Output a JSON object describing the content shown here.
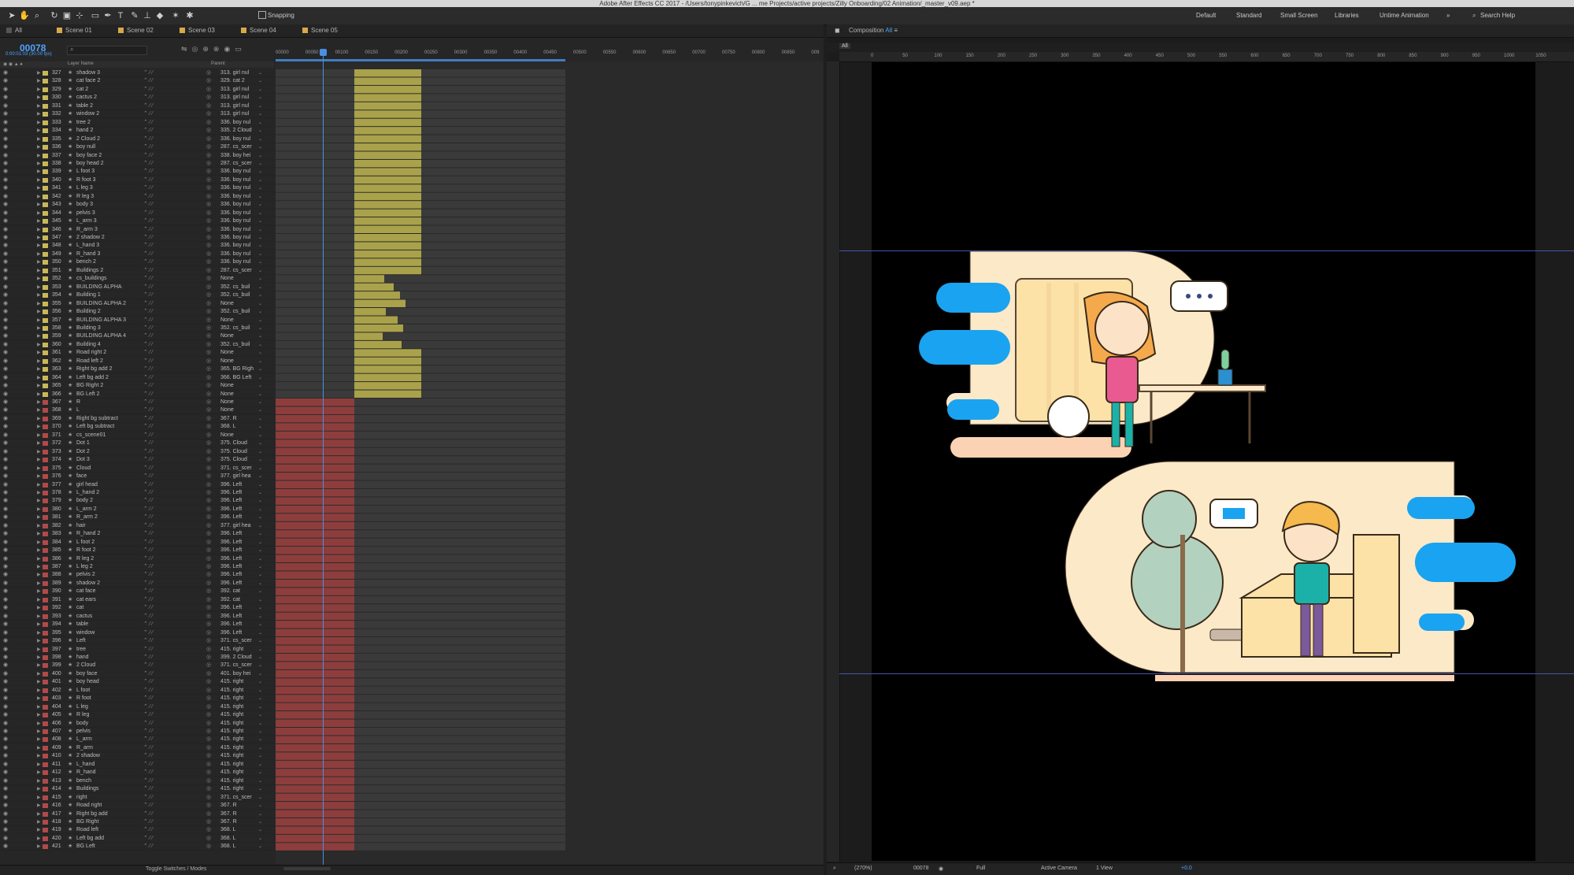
{
  "window_title": "Adobe After Effects CC 2017 - /Users/tonypinkevich/G ... me Projects/active projects/Zilly Onboarding/02 Animation/_master_v09.aep *",
  "toolbar": {
    "snapping": "Snapping",
    "workspaces": [
      "Default",
      "Standard",
      "Small Screen",
      "Libraries",
      "Untime Animation"
    ],
    "search": "Search Help"
  },
  "timeline": {
    "tabs": [
      "All",
      "Scene 01",
      "Scene 02",
      "Scene 03",
      "Scene 04",
      "Scene 05"
    ],
    "timecode": "00078",
    "timecode_sub": "0:00:01:03 (30.00 fps)",
    "columns": {
      "layer_name": "Layer Name",
      "parent": "Parent"
    },
    "ruler": [
      "00000",
      "00050",
      "00100",
      "00150",
      "00200",
      "00250",
      "00300",
      "00350",
      "00400",
      "00450",
      "00500",
      "00550",
      "00600",
      "00650",
      "00700",
      "00750",
      "00800",
      "00850",
      "009"
    ],
    "toggle": "Toggle Switches / Modes",
    "layers": [
      {
        "n": "327",
        "name": "shadow 3",
        "parent": "313. girl nul",
        "c": "#c9b85a"
      },
      {
        "n": "328",
        "name": "cat face 2",
        "parent": "329. cat 2",
        "c": "#c9b85a"
      },
      {
        "n": "329",
        "name": "cat 2",
        "parent": "313. girl nul",
        "c": "#c9b85a"
      },
      {
        "n": "330",
        "name": "cactus 2",
        "parent": "313. girl nul",
        "c": "#c9b85a"
      },
      {
        "n": "331",
        "name": "table 2",
        "parent": "313. girl nul",
        "c": "#c9b85a"
      },
      {
        "n": "332",
        "name": "window 2",
        "parent": "313. girl nul",
        "c": "#c9b85a"
      },
      {
        "n": "333",
        "name": "tree 2",
        "parent": "336. boy nul",
        "c": "#c9b85a"
      },
      {
        "n": "334",
        "name": "hand 2",
        "parent": "335. 2 Cloud",
        "c": "#c9b85a"
      },
      {
        "n": "335",
        "name": "2 Cloud 2",
        "parent": "336. boy nul",
        "c": "#c9b85a"
      },
      {
        "n": "336",
        "name": "boy null",
        "parent": "287. cs_scer",
        "c": "#c9b85a"
      },
      {
        "n": "337",
        "name": "boy face 2",
        "parent": "338. boy hei",
        "c": "#c9b85a"
      },
      {
        "n": "338",
        "name": "boy head 2",
        "parent": "287. cs_scer",
        "c": "#c9b85a"
      },
      {
        "n": "339",
        "name": "L foot 3",
        "parent": "336. boy nul",
        "c": "#c9b85a"
      },
      {
        "n": "340",
        "name": "R foot 3",
        "parent": "336. boy nul",
        "c": "#c9b85a"
      },
      {
        "n": "341",
        "name": "L leg 3",
        "parent": "336. boy nul",
        "c": "#c9b85a"
      },
      {
        "n": "342",
        "name": "R leg 3",
        "parent": "336. boy nul",
        "c": "#c9b85a"
      },
      {
        "n": "343",
        "name": "body 3",
        "parent": "336. boy nul",
        "c": "#c9b85a"
      },
      {
        "n": "344",
        "name": "pelvis 3",
        "parent": "336. boy nul",
        "c": "#c9b85a"
      },
      {
        "n": "345",
        "name": "L_arm 3",
        "parent": "336. boy nul",
        "c": "#c9b85a"
      },
      {
        "n": "346",
        "name": "R_arm 3",
        "parent": "336. boy nul",
        "c": "#c9b85a"
      },
      {
        "n": "347",
        "name": "2 shadow 2",
        "parent": "336. boy nul",
        "c": "#c9b85a"
      },
      {
        "n": "348",
        "name": "L_hand 3",
        "parent": "336. boy nul",
        "c": "#c9b85a"
      },
      {
        "n": "349",
        "name": "R_hand 3",
        "parent": "336. boy nul",
        "c": "#c9b85a"
      },
      {
        "n": "350",
        "name": "bench 2",
        "parent": "336. boy nul",
        "c": "#c9b85a"
      },
      {
        "n": "351",
        "name": "Buildings 2",
        "parent": "287. cs_scer",
        "c": "#c9b85a"
      },
      {
        "n": "352",
        "name": "cs_buildings",
        "parent": "None",
        "c": "#c9b85a"
      },
      {
        "n": "353",
        "name": "BUILDING ALPHA",
        "parent": "352. cs_buil",
        "c": "#c9b85a"
      },
      {
        "n": "354",
        "name": "Building 1",
        "parent": "352. cs_buil",
        "c": "#c9b85a"
      },
      {
        "n": "355",
        "name": "BUILDING ALPHA 2",
        "parent": "None",
        "c": "#c9b85a"
      },
      {
        "n": "356",
        "name": "Building 2",
        "parent": "352. cs_buil",
        "c": "#c9b85a"
      },
      {
        "n": "357",
        "name": "BUILDING ALPHA 3",
        "parent": "None",
        "c": "#c9b85a"
      },
      {
        "n": "358",
        "name": "Building 3",
        "parent": "352. cs_buil",
        "c": "#c9b85a"
      },
      {
        "n": "359",
        "name": "BUILDING ALPHA 4",
        "parent": "None",
        "c": "#c9b85a"
      },
      {
        "n": "360",
        "name": "Building 4",
        "parent": "352. cs_buil",
        "c": "#c9b85a"
      },
      {
        "n": "361",
        "name": "Road right 2",
        "parent": "None",
        "c": "#c9b85a"
      },
      {
        "n": "362",
        "name": "Road left 2",
        "parent": "None",
        "c": "#c9b85a"
      },
      {
        "n": "363",
        "name": "Right bg add 2",
        "parent": "365. BG Righ",
        "c": "#c9b85a"
      },
      {
        "n": "364",
        "name": "Left bg add 2",
        "parent": "366. BG Left",
        "c": "#c9b85a"
      },
      {
        "n": "365",
        "name": "BG Right 2",
        "parent": "None",
        "c": "#c9b85a"
      },
      {
        "n": "366",
        "name": "BG Left 2",
        "parent": "None",
        "c": "#c9b85a"
      },
      {
        "n": "367",
        "name": "R",
        "parent": "None",
        "c": "#b04a4a"
      },
      {
        "n": "368",
        "name": "L",
        "parent": "None",
        "c": "#b04a4a"
      },
      {
        "n": "369",
        "name": "Right bg subtract",
        "parent": "367. R",
        "c": "#b04a4a"
      },
      {
        "n": "370",
        "name": "Left bg subtract",
        "parent": "368. L",
        "c": "#b04a4a"
      },
      {
        "n": "371",
        "name": "cs_scene01",
        "parent": "None",
        "c": "#b04a4a"
      },
      {
        "n": "372",
        "name": "Dot 1",
        "parent": "375. Cloud",
        "c": "#b04a4a"
      },
      {
        "n": "373",
        "name": "Dot 2",
        "parent": "375. Cloud",
        "c": "#b04a4a"
      },
      {
        "n": "374",
        "name": "Dot 3",
        "parent": "375. Cloud",
        "c": "#b04a4a"
      },
      {
        "n": "375",
        "name": "Cloud",
        "parent": "371. cs_scer",
        "c": "#b04a4a"
      },
      {
        "n": "376",
        "name": "face",
        "parent": "377. girl hea",
        "c": "#b04a4a"
      },
      {
        "n": "377",
        "name": "girl head",
        "parent": "396. Left",
        "c": "#b04a4a"
      },
      {
        "n": "378",
        "name": "L_hand 2",
        "parent": "396. Left",
        "c": "#b04a4a"
      },
      {
        "n": "379",
        "name": "body 2",
        "parent": "396. Left",
        "c": "#b04a4a"
      },
      {
        "n": "380",
        "name": "L_arm 2",
        "parent": "396. Left",
        "c": "#b04a4a"
      },
      {
        "n": "381",
        "name": "R_arm 2",
        "parent": "396. Left",
        "c": "#b04a4a"
      },
      {
        "n": "382",
        "name": "hair",
        "parent": "377. girl hea",
        "c": "#b04a4a"
      },
      {
        "n": "383",
        "name": "R_hand 2",
        "parent": "396. Left",
        "c": "#b04a4a"
      },
      {
        "n": "384",
        "name": "L foot 2",
        "parent": "396. Left",
        "c": "#b04a4a"
      },
      {
        "n": "385",
        "name": "R foot 2",
        "parent": "396. Left",
        "c": "#b04a4a"
      },
      {
        "n": "386",
        "name": "R leg 2",
        "parent": "396. Left",
        "c": "#b04a4a"
      },
      {
        "n": "387",
        "name": "L leg 2",
        "parent": "396. Left",
        "c": "#b04a4a"
      },
      {
        "n": "388",
        "name": "pelvis 2",
        "parent": "396. Left",
        "c": "#b04a4a"
      },
      {
        "n": "389",
        "name": "shadow 2",
        "parent": "396. Left",
        "c": "#b04a4a"
      },
      {
        "n": "390",
        "name": "cat face",
        "parent": "392. cat",
        "c": "#b04a4a"
      },
      {
        "n": "391",
        "name": "cat ears",
        "parent": "392. cat",
        "c": "#b04a4a"
      },
      {
        "n": "392",
        "name": "cat",
        "parent": "396. Left",
        "c": "#b04a4a"
      },
      {
        "n": "393",
        "name": "cactus",
        "parent": "396. Left",
        "c": "#b04a4a"
      },
      {
        "n": "394",
        "name": "table",
        "parent": "396. Left",
        "c": "#b04a4a"
      },
      {
        "n": "395",
        "name": "window",
        "parent": "396. Left",
        "c": "#b04a4a"
      },
      {
        "n": "396",
        "name": "Left",
        "parent": "371. cs_scer",
        "c": "#b04a4a"
      },
      {
        "n": "397",
        "name": "tree",
        "parent": "415. right",
        "c": "#b04a4a"
      },
      {
        "n": "398",
        "name": "hand",
        "parent": "399. 2 Cloud",
        "c": "#b04a4a"
      },
      {
        "n": "399",
        "name": "2 Cloud",
        "parent": "371. cs_scer",
        "c": "#b04a4a"
      },
      {
        "n": "400",
        "name": "boy face",
        "parent": "401. boy hei",
        "c": "#b04a4a"
      },
      {
        "n": "401",
        "name": "boy head",
        "parent": "415. right",
        "c": "#b04a4a"
      },
      {
        "n": "402",
        "name": "L foot",
        "parent": "415. right",
        "c": "#b04a4a"
      },
      {
        "n": "403",
        "name": "R foot",
        "parent": "415. right",
        "c": "#b04a4a"
      },
      {
        "n": "404",
        "name": "L leg",
        "parent": "415. right",
        "c": "#b04a4a"
      },
      {
        "n": "405",
        "name": "R leg",
        "parent": "415. right",
        "c": "#b04a4a"
      },
      {
        "n": "406",
        "name": "body",
        "parent": "415. right",
        "c": "#b04a4a"
      },
      {
        "n": "407",
        "name": "pelvis",
        "parent": "415. right",
        "c": "#b04a4a"
      },
      {
        "n": "408",
        "name": "L_arm",
        "parent": "415. right",
        "c": "#b04a4a"
      },
      {
        "n": "409",
        "name": "R_arm",
        "parent": "415. right",
        "c": "#b04a4a"
      },
      {
        "n": "410",
        "name": "2 shadow",
        "parent": "415. right",
        "c": "#b04a4a"
      },
      {
        "n": "411",
        "name": "L_hand",
        "parent": "415. right",
        "c": "#b04a4a"
      },
      {
        "n": "412",
        "name": "R_hand",
        "parent": "415. right",
        "c": "#b04a4a"
      },
      {
        "n": "413",
        "name": "bench",
        "parent": "415. right",
        "c": "#b04a4a"
      },
      {
        "n": "414",
        "name": "Buildings",
        "parent": "415. right",
        "c": "#b04a4a"
      },
      {
        "n": "415",
        "name": "right",
        "parent": "371. cs_scer",
        "c": "#b04a4a"
      },
      {
        "n": "416",
        "name": "Road right",
        "parent": "367. R",
        "c": "#b04a4a"
      },
      {
        "n": "417",
        "name": "Right bg add",
        "parent": "367. R",
        "c": "#b04a4a"
      },
      {
        "n": "418",
        "name": "BG Right",
        "parent": "367. R",
        "c": "#b04a4a"
      },
      {
        "n": "419",
        "name": "Road left",
        "parent": "368. L",
        "c": "#b04a4a"
      },
      {
        "n": "420",
        "name": "Left bg add",
        "parent": "368. L",
        "c": "#b04a4a"
      },
      {
        "n": "421",
        "name": "BG Left",
        "parent": "368. L",
        "c": "#b04a4a"
      }
    ]
  },
  "composition": {
    "tab": "Composition",
    "tab_name": "All",
    "sub_tab": "All",
    "ruler": [
      "0",
      "50",
      "100",
      "150",
      "200",
      "250",
      "300",
      "350",
      "400",
      "450",
      "500",
      "550",
      "600",
      "650",
      "700",
      "750",
      "800",
      "850",
      "900",
      "950",
      "1000",
      "1050"
    ],
    "footer": {
      "zoom": "(270%)",
      "timecode": "00078",
      "resolution": "Full",
      "camera": "Active Camera",
      "view": "1 View",
      "exposure": "+0.0"
    }
  },
  "colors": {
    "yellow_label": "#c9b85a",
    "red_label": "#b04a4a",
    "yellow_bar": "#a9a24b",
    "red_bar": "#8e3d3d",
    "accent": "#4a8fe0",
    "cloud_blue": "#1aa3f0",
    "scene_bg": "#fbe9c8"
  }
}
